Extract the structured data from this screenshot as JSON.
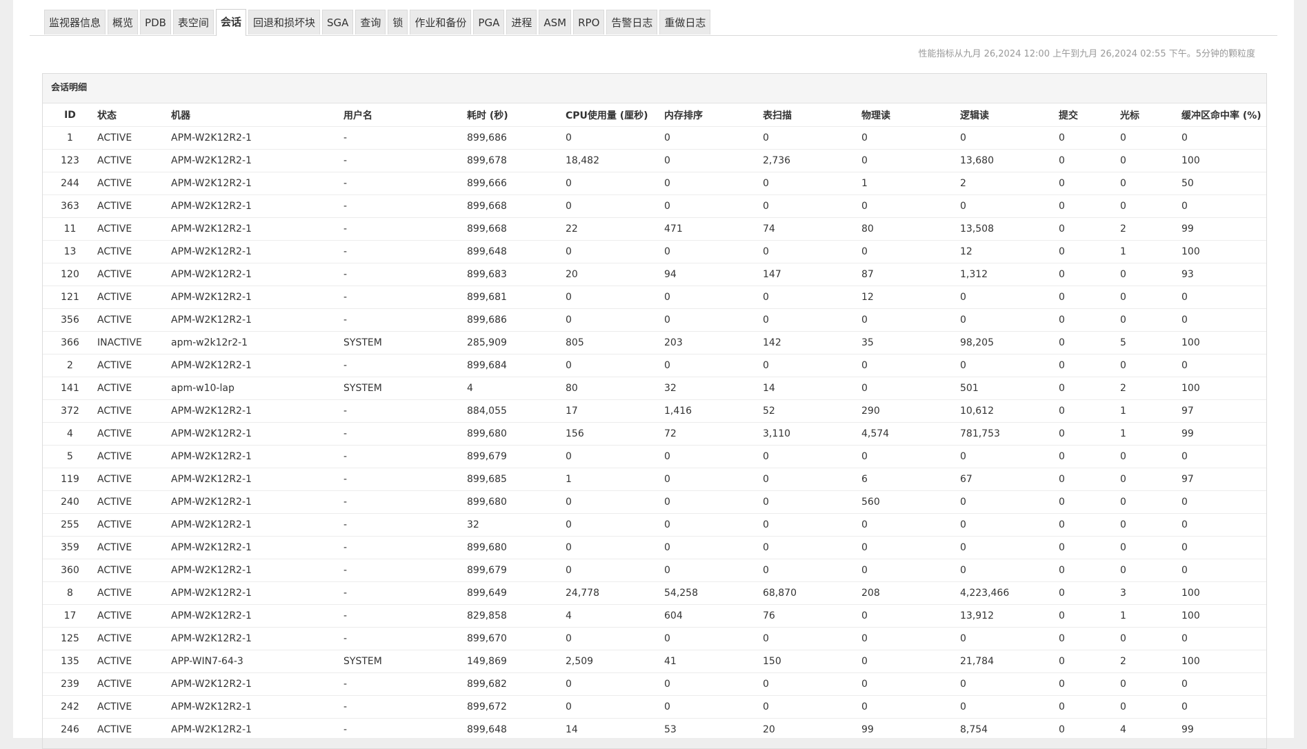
{
  "tabs": [
    {
      "label": "监视器信息",
      "active": false
    },
    {
      "label": "概览",
      "active": false
    },
    {
      "label": "PDB",
      "active": false
    },
    {
      "label": "表空间",
      "active": false
    },
    {
      "label": "会话",
      "active": true
    },
    {
      "label": "回退和损坏块",
      "active": false
    },
    {
      "label": "SGA",
      "active": false
    },
    {
      "label": "查询",
      "active": false
    },
    {
      "label": "锁",
      "active": false
    },
    {
      "label": "作业和备份",
      "active": false
    },
    {
      "label": "PGA",
      "active": false
    },
    {
      "label": "进程",
      "active": false
    },
    {
      "label": "ASM",
      "active": false
    },
    {
      "label": "RPO",
      "active": false
    },
    {
      "label": "告警日志",
      "active": false
    },
    {
      "label": "重做日志",
      "active": false
    }
  ],
  "perf_note": "性能指标从九月 26,2024 12:00 上午到九月 26,2024 02:55 下午。5分钟的颗粒度",
  "panel_title": "会话明细",
  "columns": [
    "ID",
    "状态",
    "机器",
    "用户名",
    "耗时 (秒)",
    "CPU使用量 (厘秒)",
    "内存排序",
    "表扫描",
    "物理读",
    "逻辑读",
    "提交",
    "光标",
    "缓冲区命中率 (%)"
  ],
  "rows": [
    [
      "1",
      "ACTIVE",
      "APM-W2K12R2-1",
      "-",
      "899,686",
      "0",
      "0",
      "0",
      "0",
      "0",
      "0",
      "0",
      "0"
    ],
    [
      "123",
      "ACTIVE",
      "APM-W2K12R2-1",
      "-",
      "899,678",
      "18,482",
      "0",
      "2,736",
      "0",
      "13,680",
      "0",
      "0",
      "100"
    ],
    [
      "244",
      "ACTIVE",
      "APM-W2K12R2-1",
      "-",
      "899,666",
      "0",
      "0",
      "0",
      "1",
      "2",
      "0",
      "0",
      "50"
    ],
    [
      "363",
      "ACTIVE",
      "APM-W2K12R2-1",
      "-",
      "899,668",
      "0",
      "0",
      "0",
      "0",
      "0",
      "0",
      "0",
      "0"
    ],
    [
      "11",
      "ACTIVE",
      "APM-W2K12R2-1",
      "-",
      "899,668",
      "22",
      "471",
      "74",
      "80",
      "13,508",
      "0",
      "2",
      "99"
    ],
    [
      "13",
      "ACTIVE",
      "APM-W2K12R2-1",
      "-",
      "899,648",
      "0",
      "0",
      "0",
      "0",
      "12",
      "0",
      "1",
      "100"
    ],
    [
      "120",
      "ACTIVE",
      "APM-W2K12R2-1",
      "-",
      "899,683",
      "20",
      "94",
      "147",
      "87",
      "1,312",
      "0",
      "0",
      "93"
    ],
    [
      "121",
      "ACTIVE",
      "APM-W2K12R2-1",
      "-",
      "899,681",
      "0",
      "0",
      "0",
      "12",
      "0",
      "0",
      "0",
      "0"
    ],
    [
      "356",
      "ACTIVE",
      "APM-W2K12R2-1",
      "-",
      "899,686",
      "0",
      "0",
      "0",
      "0",
      "0",
      "0",
      "0",
      "0"
    ],
    [
      "366",
      "INACTIVE",
      "apm-w2k12r2-1",
      "SYSTEM",
      "285,909",
      "805",
      "203",
      "142",
      "35",
      "98,205",
      "0",
      "5",
      "100"
    ],
    [
      "2",
      "ACTIVE",
      "APM-W2K12R2-1",
      "-",
      "899,684",
      "0",
      "0",
      "0",
      "0",
      "0",
      "0",
      "0",
      "0"
    ],
    [
      "141",
      "ACTIVE",
      "apm-w10-lap",
      "SYSTEM",
      "4",
      "80",
      "32",
      "14",
      "0",
      "501",
      "0",
      "2",
      "100"
    ],
    [
      "372",
      "ACTIVE",
      "APM-W2K12R2-1",
      "-",
      "884,055",
      "17",
      "1,416",
      "52",
      "290",
      "10,612",
      "0",
      "1",
      "97"
    ],
    [
      "4",
      "ACTIVE",
      "APM-W2K12R2-1",
      "-",
      "899,680",
      "156",
      "72",
      "3,110",
      "4,574",
      "781,753",
      "0",
      "1",
      "99"
    ],
    [
      "5",
      "ACTIVE",
      "APM-W2K12R2-1",
      "-",
      "899,679",
      "0",
      "0",
      "0",
      "0",
      "0",
      "0",
      "0",
      "0"
    ],
    [
      "119",
      "ACTIVE",
      "APM-W2K12R2-1",
      "-",
      "899,685",
      "1",
      "0",
      "0",
      "6",
      "67",
      "0",
      "0",
      "97"
    ],
    [
      "240",
      "ACTIVE",
      "APM-W2K12R2-1",
      "-",
      "899,680",
      "0",
      "0",
      "0",
      "560",
      "0",
      "0",
      "0",
      "0"
    ],
    [
      "255",
      "ACTIVE",
      "APM-W2K12R2-1",
      "-",
      "32",
      "0",
      "0",
      "0",
      "0",
      "0",
      "0",
      "0",
      "0"
    ],
    [
      "359",
      "ACTIVE",
      "APM-W2K12R2-1",
      "-",
      "899,680",
      "0",
      "0",
      "0",
      "0",
      "0",
      "0",
      "0",
      "0"
    ],
    [
      "360",
      "ACTIVE",
      "APM-W2K12R2-1",
      "-",
      "899,679",
      "0",
      "0",
      "0",
      "0",
      "0",
      "0",
      "0",
      "0"
    ],
    [
      "8",
      "ACTIVE",
      "APM-W2K12R2-1",
      "-",
      "899,649",
      "24,778",
      "54,258",
      "68,870",
      "208",
      "4,223,466",
      "0",
      "3",
      "100"
    ],
    [
      "17",
      "ACTIVE",
      "APM-W2K12R2-1",
      "-",
      "829,858",
      "4",
      "604",
      "76",
      "0",
      "13,912",
      "0",
      "1",
      "100"
    ],
    [
      "125",
      "ACTIVE",
      "APM-W2K12R2-1",
      "-",
      "899,670",
      "0",
      "0",
      "0",
      "0",
      "0",
      "0",
      "0",
      "0"
    ],
    [
      "135",
      "ACTIVE",
      "APP-WIN7-64-3",
      "SYSTEM",
      "149,869",
      "2,509",
      "41",
      "150",
      "0",
      "21,784",
      "0",
      "2",
      "100"
    ],
    [
      "239",
      "ACTIVE",
      "APM-W2K12R2-1",
      "-",
      "899,682",
      "0",
      "0",
      "0",
      "0",
      "0",
      "0",
      "0",
      "0"
    ],
    [
      "242",
      "ACTIVE",
      "APM-W2K12R2-1",
      "-",
      "899,672",
      "0",
      "0",
      "0",
      "0",
      "0",
      "0",
      "0",
      "0"
    ],
    [
      "246",
      "ACTIVE",
      "APM-W2K12R2-1",
      "-",
      "899,648",
      "14",
      "53",
      "20",
      "99",
      "8,754",
      "0",
      "4",
      "99"
    ]
  ]
}
